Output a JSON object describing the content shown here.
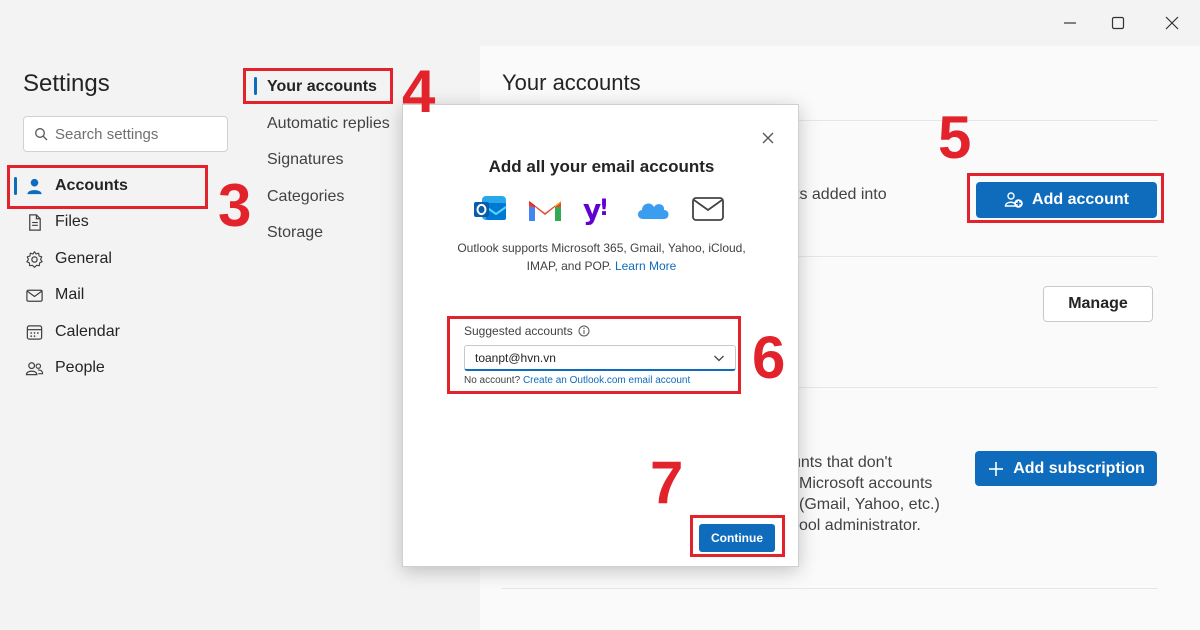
{
  "window": {
    "icons": [
      "minimize-icon",
      "maximize-icon",
      "close-icon"
    ]
  },
  "sidebar": {
    "title": "Settings",
    "search_placeholder": "Search settings",
    "items": [
      {
        "label": "Accounts",
        "icon": "person-icon",
        "active": true
      },
      {
        "label": "Files",
        "icon": "file-icon"
      },
      {
        "label": "General",
        "icon": "gear-icon"
      },
      {
        "label": "Mail",
        "icon": "mail-icon"
      },
      {
        "label": "Calendar",
        "icon": "calendar-icon"
      },
      {
        "label": "People",
        "icon": "people-icon"
      }
    ]
  },
  "submenu": {
    "items": [
      {
        "label": "Your accounts",
        "active": true
      },
      {
        "label": "Automatic replies"
      },
      {
        "label": "Signatures"
      },
      {
        "label": "Categories"
      },
      {
        "label": "Storage"
      }
    ]
  },
  "main": {
    "title": "Your accounts",
    "visible_text_1": "ts added into",
    "add_account_label": "Add account",
    "manage_label": "Manage",
    "sub_text_lines": [
      "unts that don't",
      "Microsoft accounts",
      "(Gmail, Yahoo, etc.)",
      "ool administrator."
    ],
    "add_subscription_label": "Add subscription"
  },
  "dialog": {
    "title": "Add all your email accounts",
    "providers": [
      "outlook-icon",
      "gmail-icon",
      "yahoo-icon",
      "icloud-icon",
      "generic-mail-icon"
    ],
    "description": "Outlook supports Microsoft 365, Gmail, Yahoo, iCloud, IMAP, and POP.",
    "learn_more": "Learn More",
    "suggested_label": "Suggested accounts",
    "selected_account": "toanpt@hvn.vn",
    "no_account_text": "No account?",
    "create_link": "Create an Outlook.com email account",
    "continue_label": "Continue"
  },
  "annotations": {
    "steps": [
      "3",
      "4",
      "5",
      "6",
      "7"
    ],
    "color": "#e3232b"
  },
  "colors": {
    "accent": "#0f6cbd",
    "annotation": "#e3232b"
  }
}
